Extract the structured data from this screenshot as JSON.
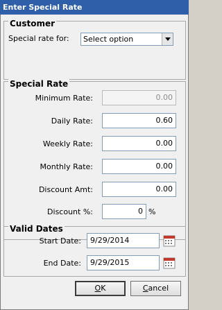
{
  "window": {
    "title": "Enter Special Rate"
  },
  "customer": {
    "group_title": "Customer",
    "special_rate_label": "Special rate for:",
    "select_value": "Select option"
  },
  "special_rate": {
    "group_title": "Special Rate",
    "minimum_label": "Minimum Rate:",
    "minimum_value": "0.00",
    "daily_label": "Daily Rate:",
    "daily_value": "0.60",
    "weekly_label": "Weekly Rate:",
    "weekly_value": "0.00",
    "monthly_label": "Monthly Rate:",
    "monthly_value": "0.00",
    "discount_amt_label": "Discount Amt:",
    "discount_amt_value": "0.00",
    "discount_pct_label": "Discount %:",
    "discount_pct_value": "0",
    "discount_pct_unit": "%"
  },
  "valid_dates": {
    "group_title": "Valid Dates",
    "start_label": "Start Date:",
    "start_value": "9/29/2014",
    "end_label": "End Date:",
    "end_value": "9/29/2015"
  },
  "buttons": {
    "ok_first": "O",
    "ok_rest": "K",
    "cancel_first": "C",
    "cancel_rest": "ancel"
  },
  "icons": {
    "calendar": "calendar-icon",
    "dropdown": "chevron-down-icon"
  }
}
